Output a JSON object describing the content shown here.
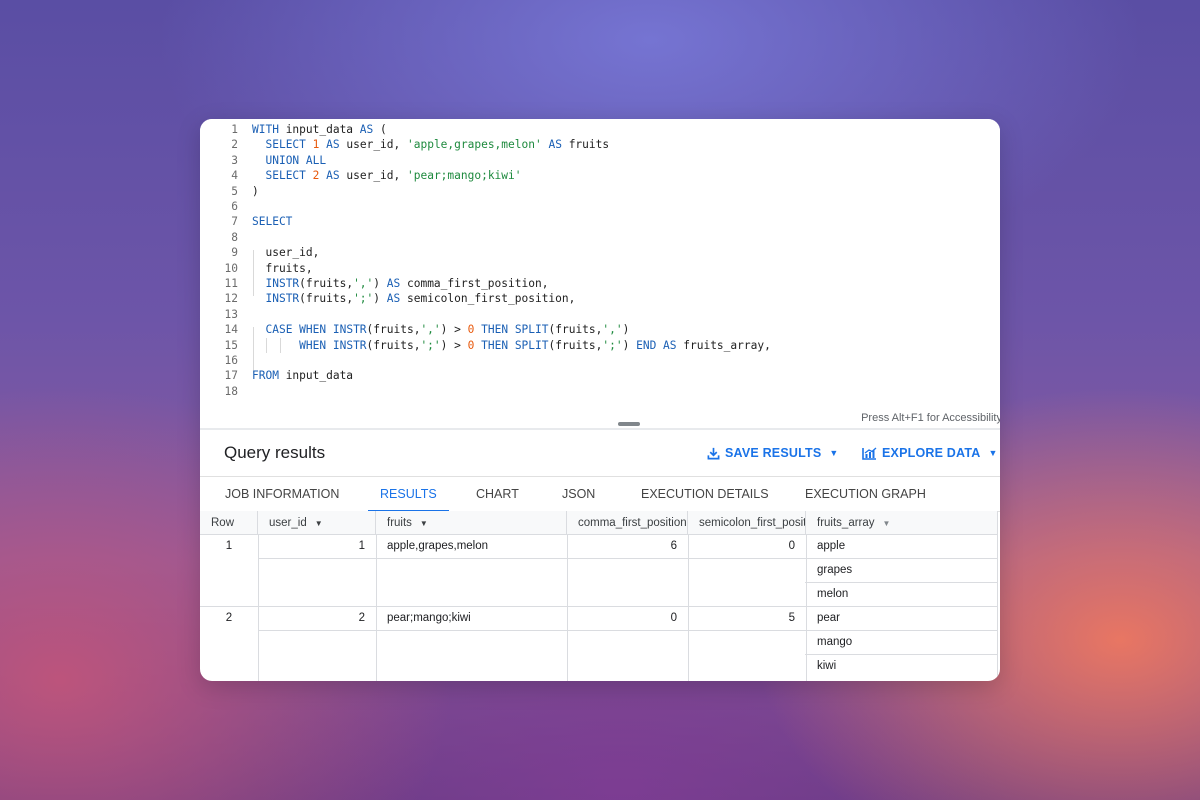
{
  "editor": {
    "lines": [
      {
        "num": "1",
        "tokens": [
          {
            "t": "WITH",
            "c": "k"
          },
          {
            "t": " input_data ",
            "c": ""
          },
          {
            "t": "AS",
            "c": "k"
          },
          {
            "t": " (",
            "c": ""
          }
        ]
      },
      {
        "num": "2",
        "tokens": [
          {
            "t": "  ",
            "c": ""
          },
          {
            "t": "SELECT",
            "c": "k"
          },
          {
            "t": " ",
            "c": ""
          },
          {
            "t": "1",
            "c": "n"
          },
          {
            "t": " ",
            "c": ""
          },
          {
            "t": "AS",
            "c": "k"
          },
          {
            "t": " user_id, ",
            "c": ""
          },
          {
            "t": "'apple,grapes,melon'",
            "c": "s"
          },
          {
            "t": " ",
            "c": ""
          },
          {
            "t": "AS",
            "c": "k"
          },
          {
            "t": " fruits",
            "c": ""
          }
        ]
      },
      {
        "num": "3",
        "tokens": [
          {
            "t": "  ",
            "c": ""
          },
          {
            "t": "UNION ALL",
            "c": "k"
          }
        ]
      },
      {
        "num": "4",
        "tokens": [
          {
            "t": "  ",
            "c": ""
          },
          {
            "t": "SELECT",
            "c": "k"
          },
          {
            "t": " ",
            "c": ""
          },
          {
            "t": "2",
            "c": "n"
          },
          {
            "t": " ",
            "c": ""
          },
          {
            "t": "AS",
            "c": "k"
          },
          {
            "t": " user_id, ",
            "c": ""
          },
          {
            "t": "'pear;mango;kiwi'",
            "c": "s"
          }
        ]
      },
      {
        "num": "5",
        "tokens": [
          {
            "t": ")",
            "c": ""
          }
        ]
      },
      {
        "num": "6",
        "tokens": []
      },
      {
        "num": "7",
        "tokens": [
          {
            "t": "SELECT",
            "c": "k"
          }
        ]
      },
      {
        "num": "8",
        "tokens": []
      },
      {
        "num": "9",
        "tokens": [
          {
            "t": "  user_id,",
            "c": ""
          }
        ]
      },
      {
        "num": "10",
        "tokens": [
          {
            "t": "  fruits,",
            "c": ""
          }
        ]
      },
      {
        "num": "11",
        "tokens": [
          {
            "t": "  ",
            "c": ""
          },
          {
            "t": "INSTR",
            "c": "k"
          },
          {
            "t": "(fruits,",
            "c": ""
          },
          {
            "t": "','",
            "c": "s"
          },
          {
            "t": ") ",
            "c": ""
          },
          {
            "t": "AS",
            "c": "k"
          },
          {
            "t": " comma_first_position,",
            "c": ""
          }
        ]
      },
      {
        "num": "12",
        "tokens": [
          {
            "t": "  ",
            "c": ""
          },
          {
            "t": "INSTR",
            "c": "k"
          },
          {
            "t": "(fruits,",
            "c": ""
          },
          {
            "t": "';'",
            "c": "s"
          },
          {
            "t": ") ",
            "c": ""
          },
          {
            "t": "AS",
            "c": "k"
          },
          {
            "t": " semicolon_first_position,",
            "c": ""
          }
        ]
      },
      {
        "num": "13",
        "tokens": []
      },
      {
        "num": "14",
        "tokens": [
          {
            "t": "  ",
            "c": ""
          },
          {
            "t": "CASE WHEN",
            "c": "k"
          },
          {
            "t": " ",
            "c": ""
          },
          {
            "t": "INSTR",
            "c": "k"
          },
          {
            "t": "(fruits,",
            "c": ""
          },
          {
            "t": "','",
            "c": "s"
          },
          {
            "t": ") > ",
            "c": ""
          },
          {
            "t": "0",
            "c": "n"
          },
          {
            "t": " ",
            "c": ""
          },
          {
            "t": "THEN",
            "c": "k"
          },
          {
            "t": " ",
            "c": ""
          },
          {
            "t": "SPLIT",
            "c": "k"
          },
          {
            "t": "(fruits,",
            "c": ""
          },
          {
            "t": "','",
            "c": "s"
          },
          {
            "t": ")",
            "c": ""
          }
        ]
      },
      {
        "num": "15",
        "tokens": [
          {
            "t": "       ",
            "c": ""
          },
          {
            "t": "WHEN",
            "c": "k"
          },
          {
            "t": " ",
            "c": ""
          },
          {
            "t": "INSTR",
            "c": "k"
          },
          {
            "t": "(fruits,",
            "c": ""
          },
          {
            "t": "';'",
            "c": "s"
          },
          {
            "t": ") > ",
            "c": ""
          },
          {
            "t": "0",
            "c": "n"
          },
          {
            "t": " ",
            "c": ""
          },
          {
            "t": "THEN",
            "c": "k"
          },
          {
            "t": " ",
            "c": ""
          },
          {
            "t": "SPLIT",
            "c": "k"
          },
          {
            "t": "(fruits,",
            "c": ""
          },
          {
            "t": "';'",
            "c": "s"
          },
          {
            "t": ") ",
            "c": ""
          },
          {
            "t": "END AS",
            "c": "k"
          },
          {
            "t": " fruits_array,",
            "c": ""
          }
        ]
      },
      {
        "num": "16",
        "tokens": []
      },
      {
        "num": "17",
        "tokens": [
          {
            "t": "FROM",
            "c": "k"
          },
          {
            "t": " input_data",
            "c": ""
          }
        ]
      },
      {
        "num": "18",
        "tokens": []
      }
    ],
    "accessibility_hint": "Press Alt+F1 for Accessibility"
  },
  "colors": {
    "keyword": "#1a5fb4",
    "string": "#1e8a3e",
    "number": "#e8590c",
    "accent": "#1a73e8"
  },
  "results": {
    "title": "Query results",
    "save_label": "SAVE RESULTS",
    "explore_label": "EXPLORE DATA",
    "tabs": [
      {
        "label": "JOB INFORMATION",
        "active": false
      },
      {
        "label": "RESULTS",
        "active": true
      },
      {
        "label": "CHART",
        "active": false
      },
      {
        "label": "JSON",
        "active": false
      },
      {
        "label": "EXECUTION DETAILS",
        "active": false
      },
      {
        "label": "EXECUTION GRAPH",
        "active": false
      }
    ],
    "columns": [
      "Row",
      "user_id",
      "fruits",
      "comma_first_position",
      "semicolon_first_position",
      "fruits_array"
    ],
    "rows": [
      {
        "row": "1",
        "user_id": "1",
        "fruits": "apple,grapes,melon",
        "comma": "6",
        "semicolon": "0",
        "array": [
          "apple",
          "grapes",
          "melon"
        ]
      },
      {
        "row": "2",
        "user_id": "2",
        "fruits": "pear;mango;kiwi",
        "comma": "0",
        "semicolon": "5",
        "array": [
          "pear",
          "mango",
          "kiwi"
        ]
      }
    ]
  }
}
